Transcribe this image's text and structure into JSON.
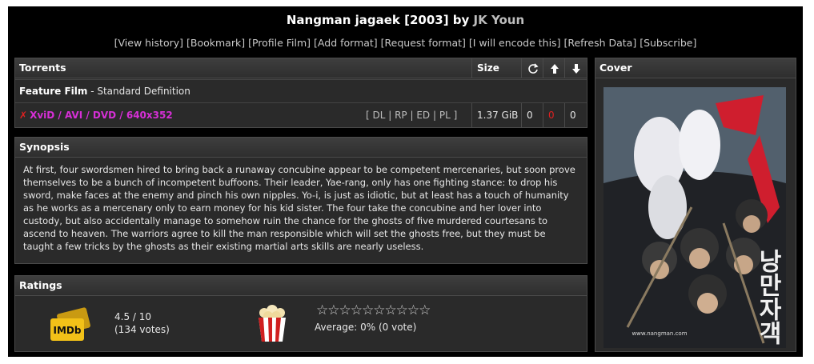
{
  "title": {
    "film": "Nangman jagaek [2003] by",
    "author": "JK Youn"
  },
  "links": [
    "[View history]",
    "[Bookmark]",
    "[Profile Film]",
    "[Add format]",
    "[Request format]",
    "[I will encode this]",
    "[Refresh Data]",
    "[Subscribe]"
  ],
  "torrents": {
    "header": "Torrents",
    "size_header": "Size",
    "icons": [
      "refresh-icon",
      "arrow-up-icon",
      "arrow-down-icon"
    ],
    "section_bold": "Feature Film",
    "section_rest": " - Standard Definition",
    "row": {
      "format": "XviD / AVI / DVD / 640x352",
      "actions": "[ DL | RP | ED | PL ]",
      "size": "1.37 GiB",
      "snatched": "0",
      "seeders": "0",
      "leechers": "0"
    },
    "colors": {
      "format": "#d62fd6",
      "seeders": "#e02020"
    }
  },
  "synopsis": {
    "header": "Synopsis",
    "text": "At first, four swordsmen hired to bring back a runaway concubine appear to be competent mercenaries, but soon prove themselves to be a bunch of incompetent buffoons. Their leader, Yae-rang, only has one fighting stance: to drop his sword, make faces at the enemy and pinch his own nipples. Yo-i, is just as idiotic, but at least has a touch of humanity as he works as a mercenary only to earn money for his kid sister. The four take the concubine and her lover into custody, but also accidentally manage to somehow ruin the chance for the ghosts of five murdered courtesans to ascend to heaven. The warriors agree to kill the man responsible which will set the ghosts free, but they must be taught a few tricks by the ghosts as their existing martial arts skills are nearly useless."
  },
  "ratings": {
    "header": "Ratings",
    "imdb_label": "IMDb",
    "imdb_score": "4.5 / 10",
    "imdb_votes": "(134 votes)",
    "stars": "☆☆☆☆☆☆☆☆☆☆",
    "average": "Average: 0% (0 vote)"
  },
  "cover": {
    "header": "Cover",
    "poster_text": "낭만자객",
    "poster_site": "www.nangman.com"
  }
}
